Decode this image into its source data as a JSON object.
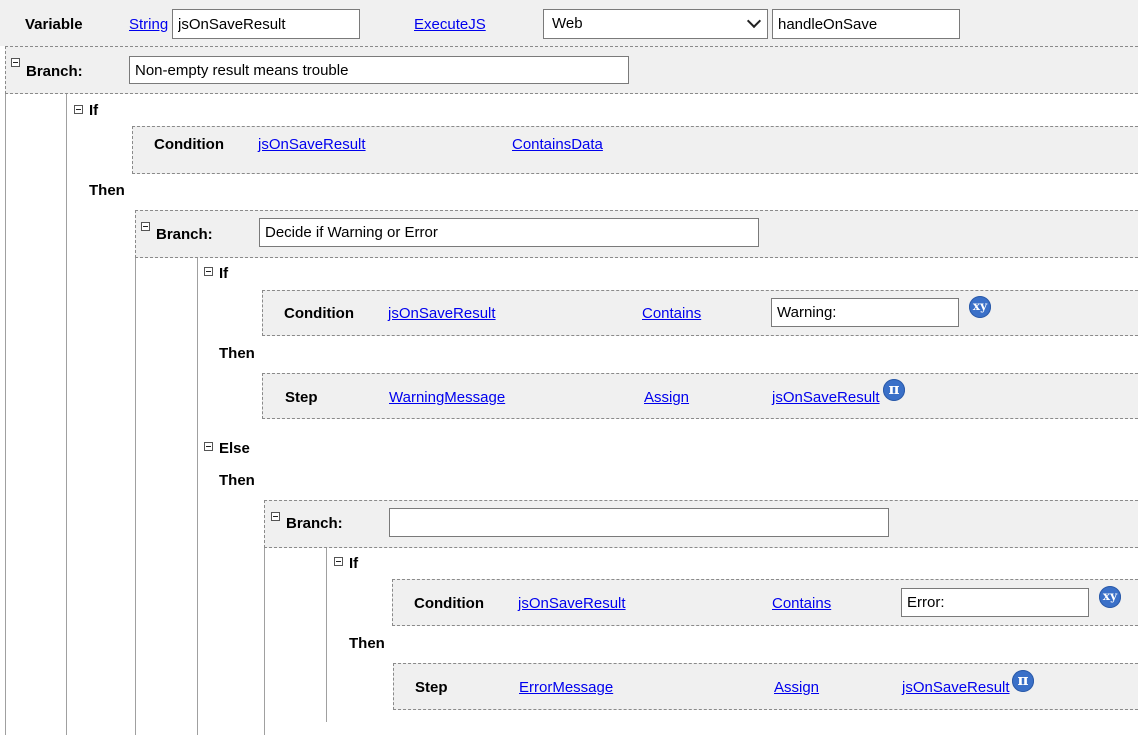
{
  "variable": {
    "label": "Variable",
    "type": "String",
    "name": "jsOnSaveResult",
    "action": "ExecuteJS",
    "target": "Web",
    "function": "handleOnSave"
  },
  "branch1": {
    "label": "Branch:",
    "description": "Non-empty result means trouble",
    "if_label": "If",
    "condition": {
      "label": "Condition",
      "variable": "jsOnSaveResult",
      "operator": "ContainsData"
    },
    "then_label": "Then"
  },
  "branch2": {
    "label": "Branch:",
    "description": "Decide if Warning or Error",
    "if_label": "If",
    "condition": {
      "label": "Condition",
      "variable": "jsOnSaveResult",
      "operator": "Contains",
      "value": "Warning:"
    },
    "then_label": "Then",
    "step": {
      "label": "Step",
      "target": "WarningMessage",
      "action": "Assign",
      "value": "jsOnSaveResult"
    },
    "else_label": "Else",
    "else_then_label": "Then"
  },
  "branch3": {
    "label": "Branch:",
    "description": "",
    "if_label": "If",
    "condition": {
      "label": "Condition",
      "variable": "jsOnSaveResult",
      "operator": "Contains",
      "value": "Error:"
    },
    "then_label": "Then",
    "step": {
      "label": "Step",
      "target": "ErrorMessage",
      "action": "Assign",
      "value": "jsOnSaveResult"
    }
  },
  "icons": {
    "variable_button": "xy",
    "formula_button": "π"
  },
  "colors": {
    "link": "#0000ee",
    "row_bg": "#f0f0f0",
    "icon_button": "#3a70c8"
  }
}
